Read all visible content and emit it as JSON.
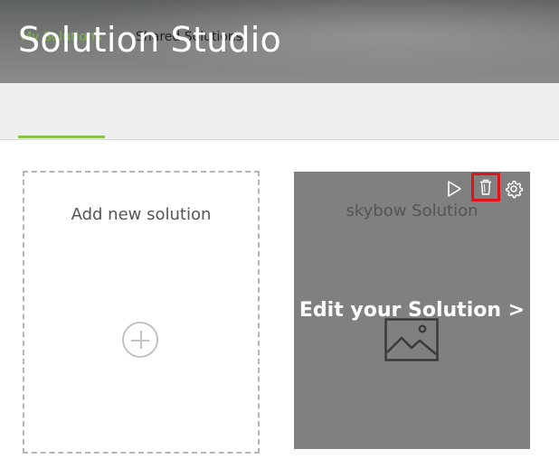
{
  "header": {
    "title": "Solution Studio"
  },
  "tabs": [
    {
      "label": "My Solutions",
      "active": true
    },
    {
      "label": "Shared Solutions",
      "active": false
    }
  ],
  "cards": {
    "add": {
      "label": "Add new solution"
    },
    "solution": {
      "title": "skybow Solution",
      "edit_label": "Edit your Solution >",
      "actions": [
        "play-icon",
        "trash-icon",
        "gear-icon"
      ]
    }
  },
  "colors": {
    "accent": "#78b843",
    "card_overlay": "#808080",
    "highlight": "#e1141c"
  }
}
